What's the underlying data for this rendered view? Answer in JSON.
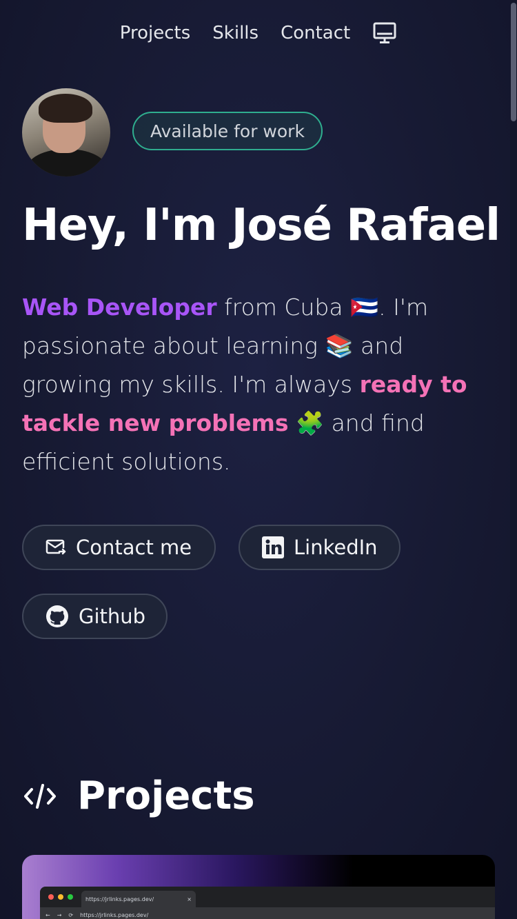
{
  "nav": {
    "items": [
      "Projects",
      "Skills",
      "Contact"
    ],
    "theme_icon": "monitor-icon"
  },
  "hero": {
    "status_badge": "Available for work",
    "title": "Hey, I'm José Rafael",
    "bio": {
      "role": "Web Developer",
      "part1": " from Cuba ",
      "flag": "🇨🇺",
      "part2": ". I'm passionate about learning ",
      "books": "📚",
      "part3": " and growing my skills. I'm always ",
      "highlight": "ready to tackle new problems",
      "part4": " ",
      "puzzle": "🧩",
      "part5": " and find efficient solutions."
    },
    "buttons": {
      "contact": {
        "label": "Contact me",
        "icon": "mail-icon"
      },
      "linkedin": {
        "label": "LinkedIn",
        "icon": "linkedin-icon"
      },
      "github": {
        "label": "Github",
        "icon": "github-icon"
      }
    }
  },
  "projects": {
    "title": "Projects",
    "icon": "code-icon",
    "preview": {
      "tab_title": "https://jrlinks.pages.dev/",
      "tab_close": "×",
      "address": "https://jrlinks.pages.dev/"
    }
  },
  "colors": {
    "accent_purple": "#a855f7",
    "accent_pink": "#f472b6",
    "badge_border": "#2fae8f",
    "background": "#171a33"
  }
}
